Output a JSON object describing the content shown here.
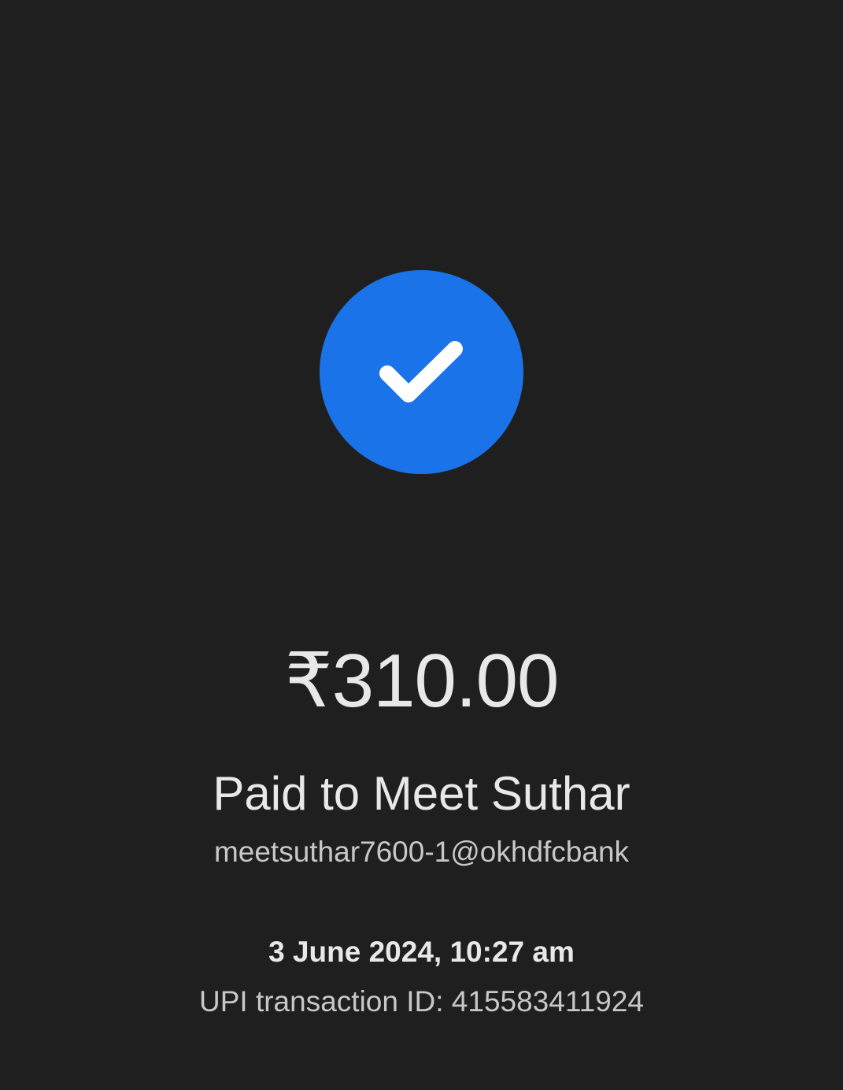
{
  "status": {
    "icon": "check-icon",
    "color": "#1a73e8"
  },
  "payment": {
    "amount": "₹310.00",
    "paid_to": "Paid to Meet Suthar",
    "upi_id": "meetsuthar7600-1@okhdfcbank",
    "datetime": "3 June 2024, 10:27 am",
    "transaction_id": "UPI transaction ID: 415583411924"
  }
}
